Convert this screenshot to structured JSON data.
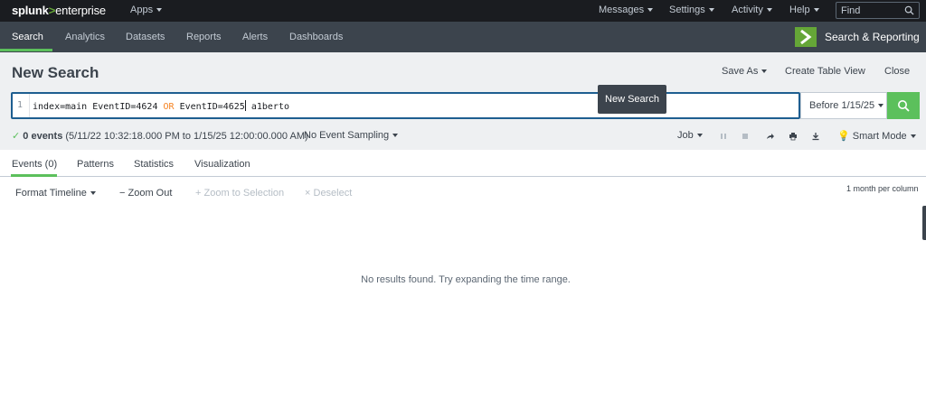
{
  "topbar": {
    "logo_main": "splunk",
    "logo_sep": ">",
    "logo_product": "enterprise",
    "apps_label": "Apps",
    "menu": {
      "messages": "Messages",
      "settings": "Settings",
      "activity": "Activity",
      "help": "Help"
    },
    "find_placeholder": "Find"
  },
  "appbar": {
    "tabs": [
      "Search",
      "Analytics",
      "Datasets",
      "Reports",
      "Alerts",
      "Dashboards"
    ],
    "app_title": "Search & Reporting",
    "accent": "#5cc05c"
  },
  "header": {
    "title": "New Search",
    "save_as": "Save As",
    "create_table_view": "Create Table View",
    "close": "Close"
  },
  "search": {
    "line_number": "1",
    "query_part1": "index=main EventID=4624 ",
    "query_keyword": "OR",
    "query_part2": " EventID=4625",
    "query_part3": " a1berto",
    "tooltip": "New Search",
    "time_range": "Before 1/15/25"
  },
  "status": {
    "count": "0 events",
    "range": " (5/11/22 10:32:18.000 PM to 1/15/25 12:00:00.000 AM)",
    "sampling": "No Event Sampling",
    "job": "Job",
    "mode": "Smart Mode"
  },
  "results_tabs": [
    "Events (0)",
    "Patterns",
    "Statistics",
    "Visualization"
  ],
  "timeline": {
    "format": "Format Timeline",
    "zoom_out": "Zoom Out",
    "zoom_selection": "Zoom to Selection",
    "deselect": "Deselect",
    "scale": "1 month per column"
  },
  "message": "No results found. Try expanding the time range."
}
